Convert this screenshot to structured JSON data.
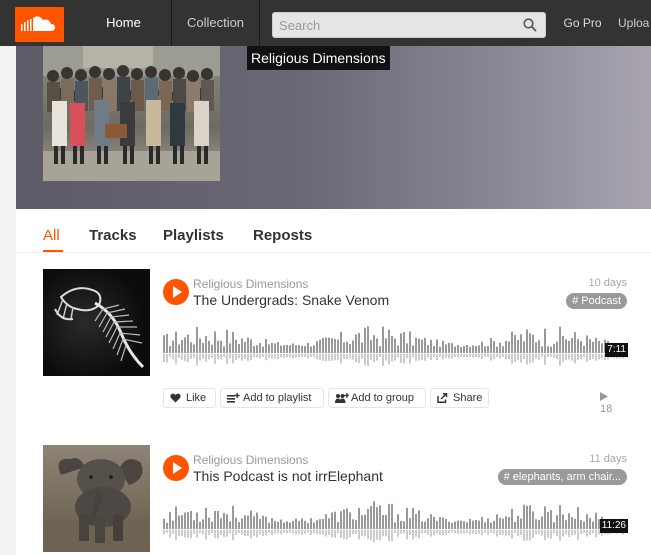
{
  "nav": {
    "home": "Home",
    "collection": "Collection",
    "search_placeholder": "Search",
    "gopro": "Go Pro",
    "upload": "Uploa"
  },
  "profile": {
    "name": "Religious Dimensions"
  },
  "tabs": {
    "all": "All",
    "tracks": "Tracks",
    "playlists": "Playlists",
    "reposts": "Reposts"
  },
  "tracks": [
    {
      "user": "Religious Dimensions",
      "title": "The Undergrads: Snake Venom",
      "age": "10 days",
      "tag": "# Podcast",
      "duration": "7:11",
      "plays": "18"
    },
    {
      "user": "Religious Dimensions",
      "title": "This Podcast is not irrElephant",
      "age": "11 days",
      "tag": "# elephants, arm chair...",
      "duration": "11:26"
    }
  ],
  "actions": {
    "like": "Like",
    "add_to_playlist": "Add to playlist",
    "add_to_group": "Add to group",
    "share": "Share"
  },
  "colors": {
    "accent": "#ff5500",
    "topbar": "#333333"
  }
}
